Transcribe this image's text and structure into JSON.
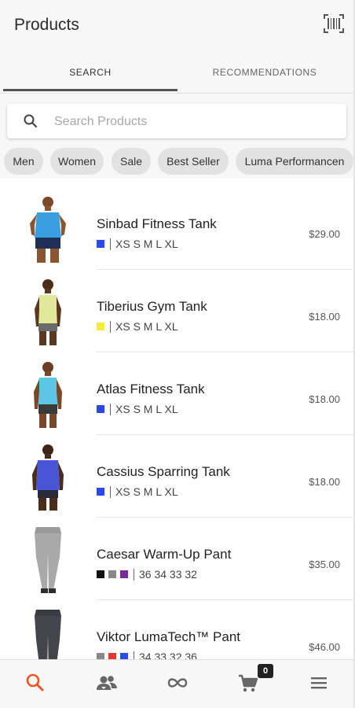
{
  "header": {
    "title": "Products",
    "barcode_icon": "barcode-scan-icon"
  },
  "tabs": [
    {
      "label": "SEARCH",
      "active": true
    },
    {
      "label": "RECOMMENDATIONS",
      "active": false
    }
  ],
  "search": {
    "placeholder": "Search Products",
    "value": "",
    "icon": "search-icon"
  },
  "chips": [
    "Men",
    "Women",
    "Sale",
    "Best Seller",
    "Luma Performancen"
  ],
  "products": [
    {
      "name": "Sinbad Fitness Tank",
      "colors": [
        "#2a4bf2"
      ],
      "sizes": "XS S M L XL",
      "price": "$29.00",
      "image": "man-blue-tank"
    },
    {
      "name": "Tiberius Gym Tank",
      "colors": [
        "#f4ec3b"
      ],
      "sizes": "XS S M L XL",
      "price": "$18.00",
      "image": "man-yellow-tank"
    },
    {
      "name": "Atlas Fitness Tank",
      "colors": [
        "#2a4bf2"
      ],
      "sizes": "XS S M L XL",
      "price": "$18.00",
      "image": "man-cyan-tank"
    },
    {
      "name": "Cassius Sparring Tank",
      "colors": [
        "#2a4bf2"
      ],
      "sizes": "XS S M L XL",
      "price": "$18.00",
      "image": "man-blue-sleeveless"
    },
    {
      "name": "Caesar Warm-Up Pant",
      "colors": [
        "#111111",
        "#888888",
        "#7a2a9a"
      ],
      "sizes": "36 34 33 32",
      "price": "$35.00",
      "image": "gray-sweatpants"
    },
    {
      "name": "Viktor LumaTech™ Pant",
      "colors": [
        "#888888",
        "#e8372c",
        "#2a4bf2"
      ],
      "sizes": "34 33 32 36",
      "price": "$46.00",
      "image": "dark-pants"
    }
  ],
  "bottom_nav": [
    {
      "name": "search-nav",
      "icon": "search-icon",
      "active": true
    },
    {
      "name": "people-nav",
      "icon": "people-icon",
      "active": false
    },
    {
      "name": "infinity-nav",
      "icon": "infinity-icon",
      "active": false
    },
    {
      "name": "cart-nav",
      "icon": "cart-icon",
      "active": false
    },
    {
      "name": "menu-nav",
      "icon": "hamburger-menu-icon",
      "active": false
    }
  ],
  "cart": {
    "count": "0"
  },
  "colors": {
    "accent": "#e8562a",
    "nav_icon": "#666666",
    "chip_bg": "#e2e2e2",
    "bar_bg": "#f7f7f7"
  }
}
